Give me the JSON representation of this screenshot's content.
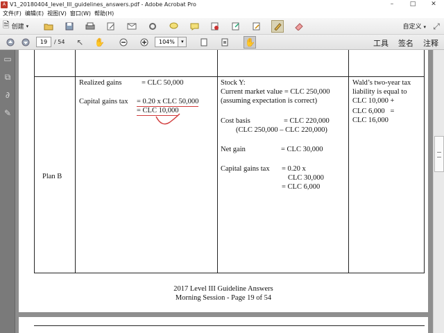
{
  "window": {
    "title": "V1_20180404_level_III_guidelines_answers.pdf - Adobe Acrobat Pro",
    "controls": [
      "–",
      "□",
      "✕"
    ]
  },
  "menu": [
    "文件(F)",
    "编辑(E)",
    "视图(V)",
    "窗口(W)",
    "帮助(H)"
  ],
  "toolbar": {
    "create_label": "创建",
    "customize_label": "自定义",
    "tools": [
      "folder-open-icon",
      "save-icon",
      "print-icon",
      "edit-icon",
      "email-icon",
      "settings-icon",
      "comment-icon",
      "sign-icon",
      "pdf-icon",
      "export-icon",
      "combine-icon",
      "highlight-icon",
      "eraser-icon"
    ]
  },
  "nav": {
    "page_current": "19",
    "page_total": "/ 54",
    "zoom": "104%",
    "panels": [
      "工具",
      "签名",
      "注释"
    ]
  },
  "document": {
    "row_label": "Plan B",
    "col1": {
      "realized_gains_label": "Realized gains",
      "realized_gains_value": "= CLC 50,000",
      "tax_label": "Capital gains tax",
      "tax_formula": "= 0.20 x CLC 50,000",
      "tax_result": "= CLC 10,000"
    },
    "col2": {
      "stock_label": "Stock Y:",
      "market_value": "Current market value = CLC 250,000",
      "assumption": "(assuming expectation is correct)",
      "cost_basis_label": "Cost basis",
      "cost_basis_value": "= CLC 220,000",
      "cost_basis_calc": "(CLC 250,000 – CLC 220,000)",
      "net_gain_label": "Net gain",
      "net_gain_value": "= CLC 30,000",
      "cgt_label": "Capital gains tax",
      "cgt_line1": "= 0.20 x",
      "cgt_line2": "CLC 30,000",
      "cgt_line3": "= CLC 6,000"
    },
    "col3": {
      "line1": "Wald’s two-year tax",
      "line2": "liability is equal to",
      "line3": "CLC 10,000 +",
      "line4": "CLC 6,000   =",
      "line5": "CLC 16,000"
    },
    "footer_line1": "2017 Level III Guideline Answers",
    "footer_line2": "Morning Session - Page 19 of 54"
  }
}
